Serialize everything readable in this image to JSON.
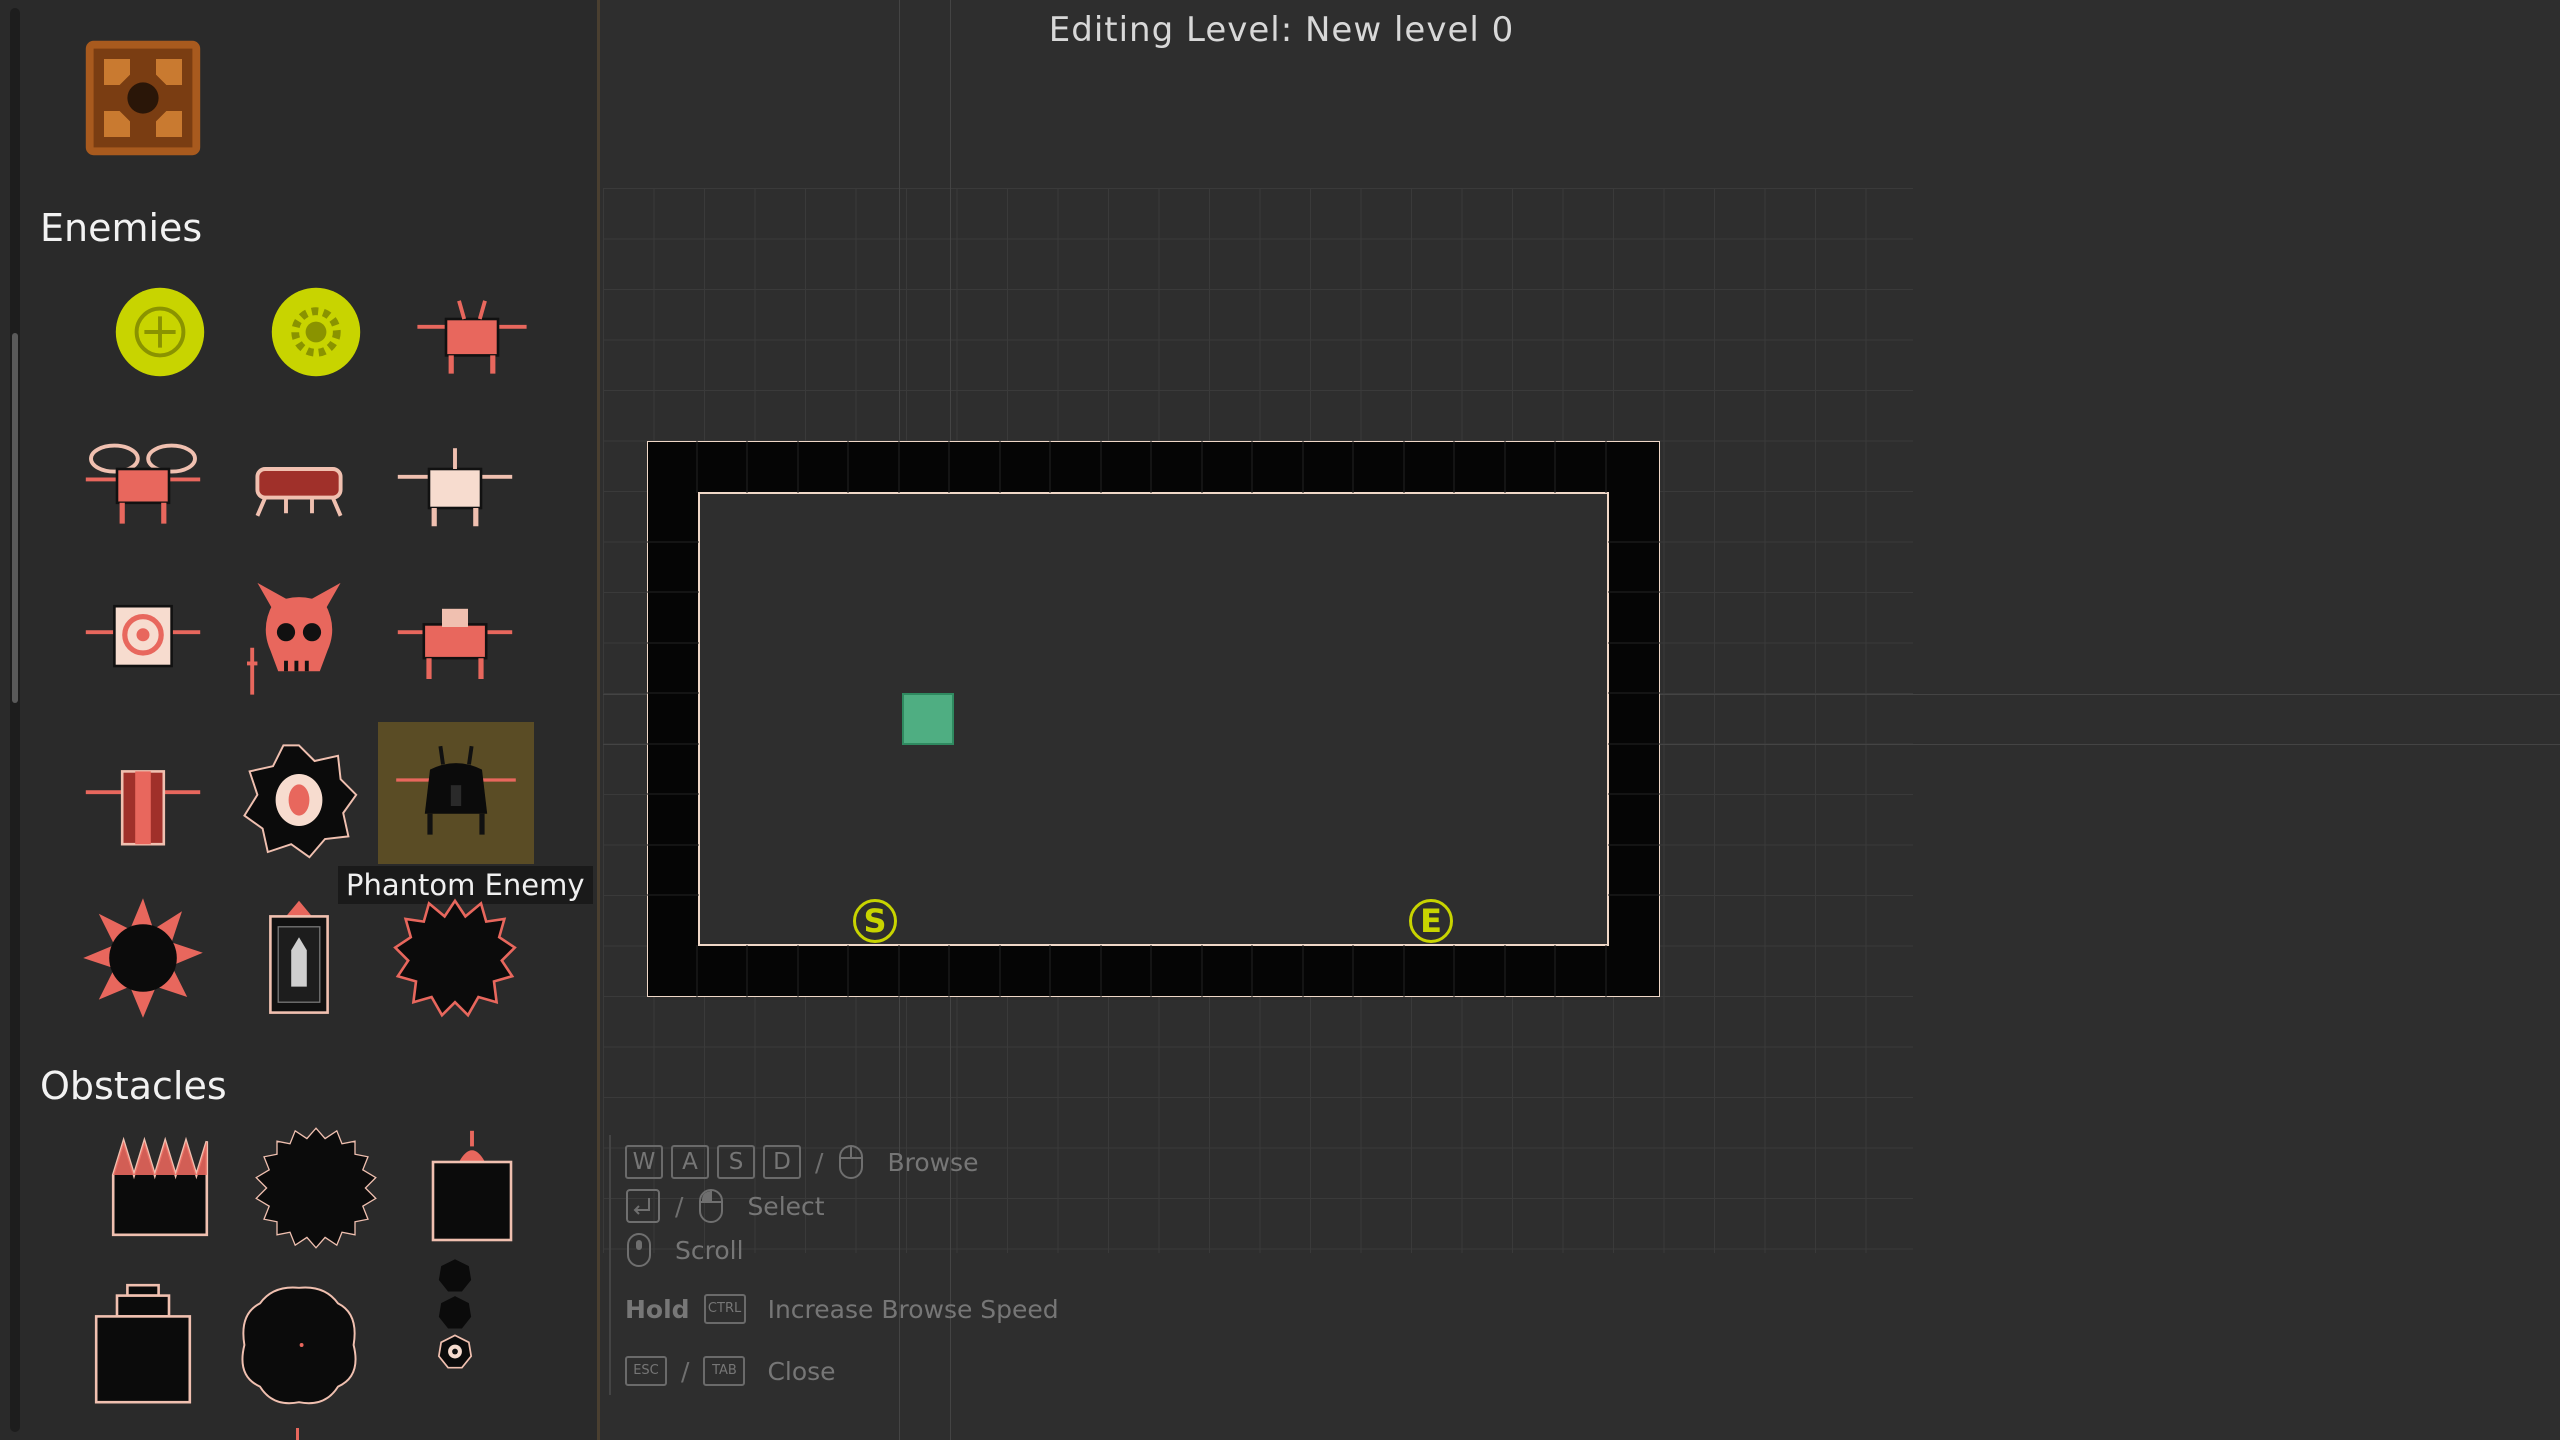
{
  "editor": {
    "title": "Editing Level: New level 0"
  },
  "palette": {
    "top_tile": "rusty-crate-tile",
    "sections": [
      {
        "title": "Enemies",
        "items": [
          "yellow-plus-orb-enemy",
          "yellow-gear-orb-enemy",
          "red-antenna-drone-enemy",
          "red-winged-drone-enemy",
          "red-crab-walker-enemy",
          "pale-antenna-drone-enemy",
          "target-drone-enemy",
          "demon-skull-swordsman-enemy",
          "red-wide-drone-enemy",
          "red-pillar-drone-enemy",
          "eye-sawblade-enemy",
          "phantom-enemy",
          "spiked-mine-enemy",
          "rocket-pod-enemy",
          "jagged-blob-enemy"
        ]
      },
      {
        "title": "Obstacles",
        "items": [
          "spike-block-obstacle",
          "sawblade-obstacle",
          "turret-block-obstacle",
          "capped-block-obstacle",
          "big-blob-obstacle",
          "chain-mine-obstacle"
        ]
      }
    ],
    "selected_item": "phantom-enemy",
    "tooltip": "Phantom Enemy"
  },
  "level": {
    "start_marker": "S",
    "end_marker": "E"
  },
  "help": {
    "browse_keys": [
      "W",
      "A",
      "S",
      "D"
    ],
    "browse_label": "Browse",
    "select_label": "Select",
    "scroll_label": "Scroll",
    "hold_label": "Hold",
    "ctrl_key": "CTRL",
    "speed_label": "Increase Browse Speed",
    "esc_key": "ESC",
    "tab_key": "TAB",
    "close_label": "Close"
  },
  "colors": {
    "accent_yellow": "#c8d400",
    "enemy_red": "#e8675d",
    "selection_bg": "#5a4c25",
    "player_green": "#4fae82"
  }
}
